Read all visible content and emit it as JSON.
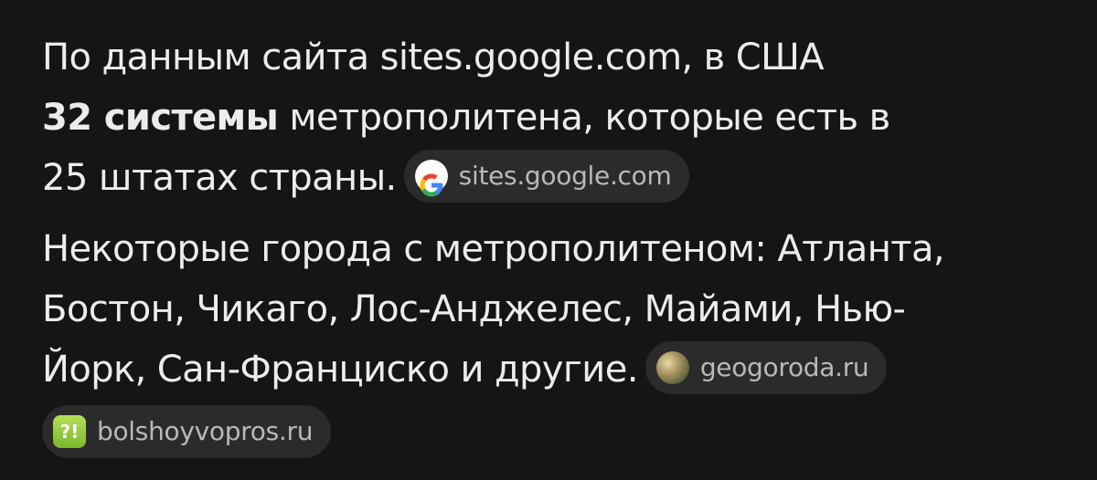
{
  "answer": {
    "p1": {
      "line1": "По данным сайта sites.google.com, в США",
      "bold": "32 системы",
      "line2_rest": " метрополитена, которые есть в",
      "line3": "25 штатах страны."
    },
    "p2": {
      "line1": "Некоторые города с метрополитеном: Атланта,",
      "line2": "Бостон, Чикаго, Лос-Анджелес, Майами, Нью-",
      "line3": "Йорк, Сан-Франциско и другие."
    }
  },
  "sources": {
    "google": {
      "label": "sites.google.com",
      "icon": "google-logo-icon"
    },
    "geogoroda": {
      "label": "geogoroda.ru",
      "icon": "geogoroda-favicon-icon"
    },
    "bolshoyvopros": {
      "label": "bolshoyvopros.ru",
      "icon": "bolshoyvopros-favicon-icon",
      "icon_text": "?!"
    }
  }
}
